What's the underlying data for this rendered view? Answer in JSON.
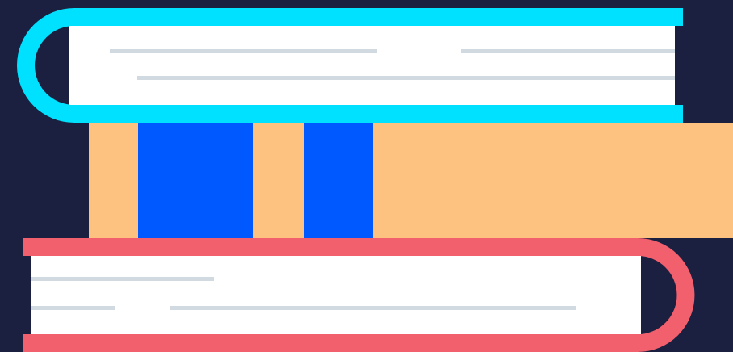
{
  "colors": {
    "background": "#1b2040",
    "top_book_cover": "#00e1ff",
    "top_book_pages": "#ffffff",
    "middle_book_cover": "#fdc180",
    "middle_book_stripes": "#0058ff",
    "bottom_book_cover": "#f2606e",
    "bottom_book_pages": "#ffffff",
    "page_lines": "#d2dae1"
  },
  "illustration": {
    "subject": "stack-of-books",
    "book_count": 3
  }
}
